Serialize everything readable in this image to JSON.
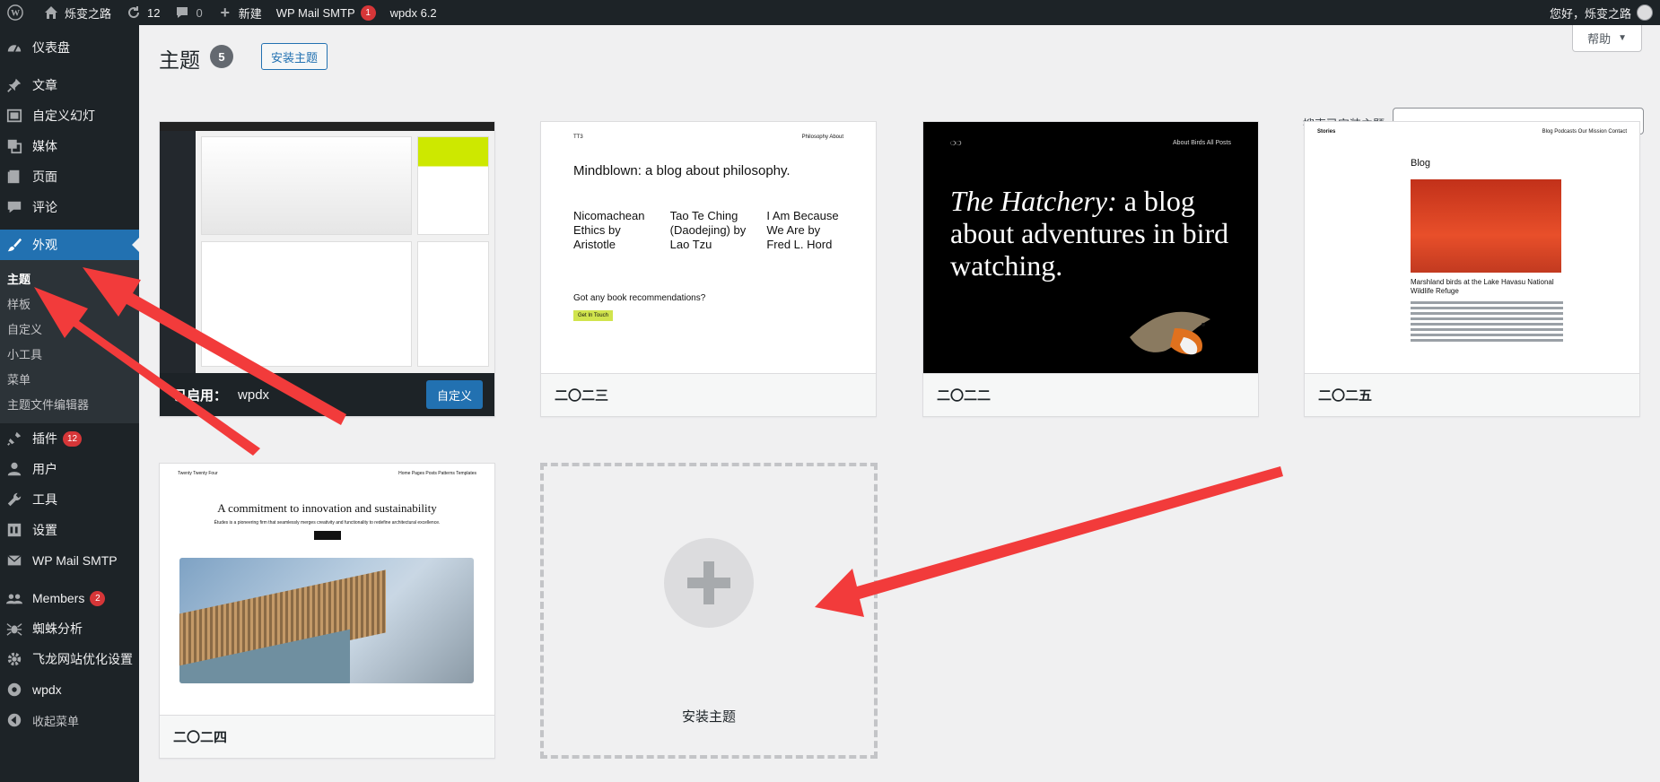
{
  "adminbar": {
    "site_name": "烁变之路",
    "updates_count": "12",
    "comments_count": "0",
    "new_label": "新建",
    "smtp_label": "WP Mail SMTP",
    "smtp_badge": "1",
    "wpdx_label": "wpdx 6.2",
    "greeting": "您好，烁变之路"
  },
  "sidebar": {
    "dashboard": "仪表盘",
    "posts": "文章",
    "slides": "自定义幻灯",
    "media": "媒体",
    "pages": "页面",
    "comments": "评论",
    "appearance": "外观",
    "appearance_sub": [
      "主题",
      "样板",
      "自定义",
      "小工具",
      "菜单",
      "主题文件编辑器"
    ],
    "plugins": "插件",
    "plugins_badge": "12",
    "users": "用户",
    "tools": "工具",
    "settings": "设置",
    "smtp": "WP Mail SMTP",
    "members": "Members",
    "members_badge": "2",
    "spider": "蜘蛛分析",
    "feilong": "飞龙网站优化设置",
    "wpdx": "wpdx",
    "collapse": "收起菜单"
  },
  "main": {
    "title": "主题",
    "count": "5",
    "add_theme": "安装主题",
    "help": "帮助",
    "search_label": "搜索已安装主题",
    "search_value": ""
  },
  "themes": {
    "active_prefix": "已启用：",
    "active_name": "wpdx",
    "customize": "自定义",
    "t2023": {
      "name": "二〇二三",
      "brand": "TT3",
      "nav": "Philosophy   About",
      "headline": "Mindblown: a blog about philosophy.",
      "posts": [
        "Nicomachean Ethics by Aristotle",
        "Tao Te Ching (Daodejing) by Lao Tzu",
        "I Am Because We Are by Fred L. Hord"
      ],
      "question": "Got any book recommendations?",
      "button": "Get In Touch"
    },
    "t2022": {
      "name": "二〇二二",
      "nav": "About    Birds    All Posts",
      "headline_italic": "The Hatchery:",
      "headline_rest": " a blog about adventures in bird watching."
    },
    "t2025": {
      "name": "二〇二五",
      "brand": "Stories",
      "nav": "Blog   Podcasts   Our Mission   Contact",
      "blog": "Blog",
      "caption": "Marshland birds at the Lake Havasu National Wildlife Refuge"
    },
    "t2024": {
      "name": "二〇二四",
      "brand": "Twenty Twenty Four",
      "nav": "Home  Pages  Posts  Patterns  Templates",
      "headline": "A commitment to innovation and sustainability",
      "sub": "Études is a pioneering firm that seamlessly merges creativity and functionality to redefine architectural excellence."
    },
    "add_new_label": "安装主题"
  },
  "colors": {
    "accent": "#2271b1",
    "annotation_arrow": "#f23b3b",
    "badge": "#d63638"
  }
}
